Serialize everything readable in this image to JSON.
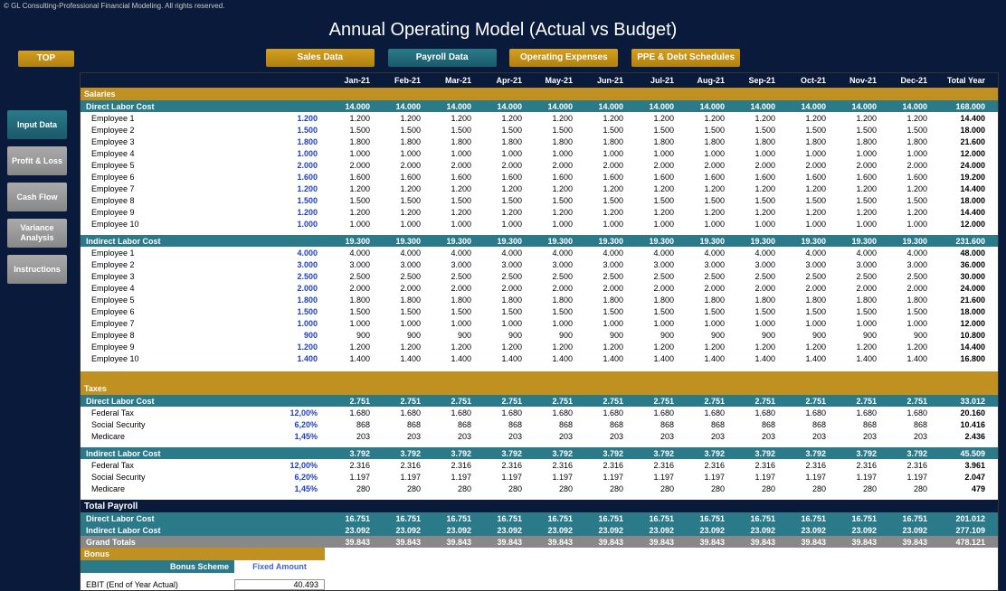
{
  "copyright": "© GL Consulting-Professional Financial Modeling. All rights reserved.",
  "title": "Annual Operating Model (Actual vs Budget)",
  "top_button": "TOP",
  "nav": {
    "sales": "Sales Data",
    "payroll": "Payroll Data",
    "opex": "Operating Expenses",
    "ppe": "PPE & Debt Schedules"
  },
  "side": {
    "input": "Input Data",
    "pl": "Profit & Loss",
    "cf": "Cash Flow",
    "va": "Variance Analysis",
    "instr": "Instructions"
  },
  "months": [
    "Jan-21",
    "Feb-21",
    "Mar-21",
    "Apr-21",
    "May-21",
    "Jun-21",
    "Jul-21",
    "Aug-21",
    "Sep-21",
    "Oct-21",
    "Nov-21",
    "Dec-21"
  ],
  "total_label": "Total Year",
  "sections": {
    "salaries": "Salaries",
    "taxes": "Taxes",
    "total_payroll": "Total Payroll",
    "bonus": "Bonus"
  },
  "direct": {
    "label": "Direct Labor Cost",
    "month_total": "14.000",
    "year_total": "168.000",
    "rows": [
      {
        "name": "Employee 1",
        "input": "1.200",
        "val": "1.200",
        "total": "14.400"
      },
      {
        "name": "Employee 2",
        "input": "1.500",
        "val": "1.500",
        "total": "18.000"
      },
      {
        "name": "Employee 3",
        "input": "1.800",
        "val": "1.800",
        "total": "21.600"
      },
      {
        "name": "Employee 4",
        "input": "1.000",
        "val": "1.000",
        "total": "12.000"
      },
      {
        "name": "Employee 5",
        "input": "2.000",
        "val": "2.000",
        "total": "24.000"
      },
      {
        "name": "Employee 6",
        "input": "1.600",
        "val": "1.600",
        "total": "19.200"
      },
      {
        "name": "Employee 7",
        "input": "1.200",
        "val": "1.200",
        "total": "14.400"
      },
      {
        "name": "Employee 8",
        "input": "1.500",
        "val": "1.500",
        "total": "18.000"
      },
      {
        "name": "Employee 9",
        "input": "1.200",
        "val": "1.200",
        "total": "14.400"
      },
      {
        "name": "Employee 10",
        "input": "1.000",
        "val": "1.000",
        "total": "12.000"
      }
    ]
  },
  "indirect": {
    "label": "Indirect Labor Cost",
    "month_total": "19.300",
    "year_total": "231.600",
    "rows": [
      {
        "name": "Employee 1",
        "input": "4.000",
        "val": "4.000",
        "total": "48.000"
      },
      {
        "name": "Employee 2",
        "input": "3.000",
        "val": "3.000",
        "total": "36.000"
      },
      {
        "name": "Employee 3",
        "input": "2.500",
        "val": "2.500",
        "total": "30.000"
      },
      {
        "name": "Employee 4",
        "input": "2.000",
        "val": "2.000",
        "total": "24.000"
      },
      {
        "name": "Employee 5",
        "input": "1.800",
        "val": "1.800",
        "total": "21.600"
      },
      {
        "name": "Employee 6",
        "input": "1.500",
        "val": "1.500",
        "total": "18.000"
      },
      {
        "name": "Employee 7",
        "input": "1.000",
        "val": "1.000",
        "total": "12.000"
      },
      {
        "name": "Employee 8",
        "input": "900",
        "val": "900",
        "total": "10.800"
      },
      {
        "name": "Employee 9",
        "input": "1.200",
        "val": "1.200",
        "total": "14.400"
      },
      {
        "name": "Employee 10",
        "input": "1.400",
        "val": "1.400",
        "total": "16.800"
      }
    ]
  },
  "taxes_direct": {
    "label": "Direct Labor Cost",
    "month_total": "2.751",
    "year_total": "33.012",
    "rows": [
      {
        "name": "Federal Tax",
        "input": "12,00%",
        "val": "1.680",
        "total": "20.160"
      },
      {
        "name": "Social Security",
        "input": "6,20%",
        "val": "868",
        "total": "10.416"
      },
      {
        "name": "Medicare",
        "input": "1,45%",
        "val": "203",
        "total": "2.436"
      }
    ]
  },
  "taxes_indirect": {
    "label": "Indirect Labor Cost",
    "month_total": "3.792",
    "year_total": "45.509",
    "rows": [
      {
        "name": "Federal Tax",
        "input": "12,00%",
        "val": "2.316",
        "total": "3.961"
      },
      {
        "name": "Social Security",
        "input": "6,20%",
        "val": "1.197",
        "total": "2.047"
      },
      {
        "name": "Medicare",
        "input": "1,45%",
        "val": "280",
        "total": "479"
      }
    ]
  },
  "summary": {
    "direct": {
      "label": "Direct Labor Cost",
      "val": "16.751",
      "total": "201.012"
    },
    "indirect": {
      "label": "Indirect Labor Cost",
      "val": "23.092",
      "total": "277.109"
    },
    "grand": {
      "label": "Grand Totals",
      "val": "39.843",
      "total": "478.121"
    }
  },
  "bonus": {
    "scheme_label": "Bonus Scheme",
    "scheme_value": "Fixed Amount",
    "ebit_label": "EBIT (End of Year Actual)",
    "ebit_value": "40.493"
  }
}
